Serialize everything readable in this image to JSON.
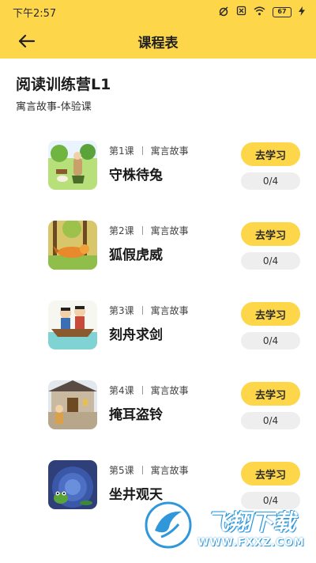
{
  "status_bar": {
    "time": "下午2:57",
    "battery": "67"
  },
  "nav": {
    "title": "课程表"
  },
  "course": {
    "title": "阅读训练营L1",
    "subtitle": "寓言故事-体验课"
  },
  "lessons": [
    {
      "number": "第1课",
      "category": "寓言故事",
      "name": "守株待兔",
      "button": "去学习",
      "progress": "0/4"
    },
    {
      "number": "第2课",
      "category": "寓言故事",
      "name": "狐假虎威",
      "button": "去学习",
      "progress": "0/4"
    },
    {
      "number": "第3课",
      "category": "寓言故事",
      "name": "刻舟求剑",
      "button": "去学习",
      "progress": "0/4"
    },
    {
      "number": "第4课",
      "category": "寓言故事",
      "name": "掩耳盗铃",
      "button": "去学习",
      "progress": "0/4"
    },
    {
      "number": "第5课",
      "category": "寓言故事",
      "name": "坐井观天",
      "button": "去学习",
      "progress": "0/4"
    }
  ],
  "watermark": {
    "cn": "飞翔下载",
    "en": "WWW.FXXZ.COM"
  },
  "colors": {
    "accent": "#fdd64a",
    "progress_bg": "#eeeeee"
  }
}
